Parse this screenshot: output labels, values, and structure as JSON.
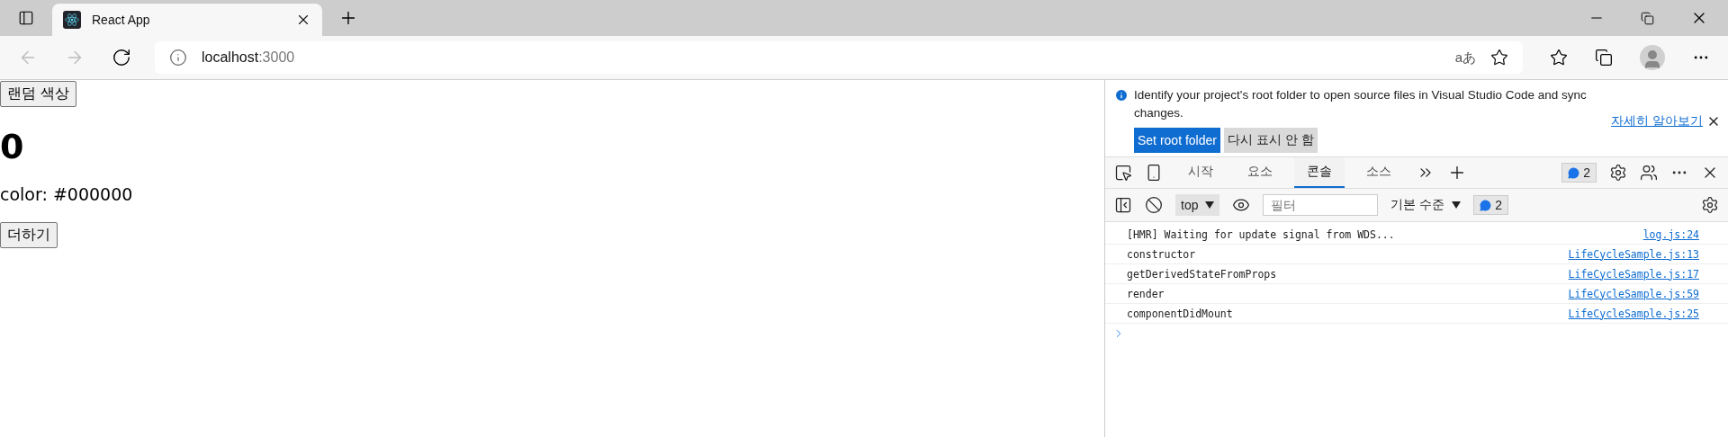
{
  "browser": {
    "tabs": [
      {
        "title": "React App",
        "selected": true
      }
    ],
    "address": {
      "host": "localhost",
      "port": ":3000"
    },
    "translate_label": "aあ"
  },
  "page": {
    "random_button": "랜덤 색상",
    "number": "0",
    "color_text": "color: #000000",
    "add_button": "더하기"
  },
  "devtools": {
    "infobar": {
      "message": "Identify your project's root folder to open source files in Visual Studio Code and sync changes.",
      "learn_more": "자세히 알아보기",
      "primary_button": "Set root folder",
      "secondary_button": "다시 표시 안 함"
    },
    "tabs": [
      {
        "label": "시작",
        "selected": false
      },
      {
        "label": "요소",
        "selected": false
      },
      {
        "label": "콘솔",
        "selected": true
      },
      {
        "label": "소스",
        "selected": false
      }
    ],
    "issues_count": "2",
    "toolbar": {
      "context": "top",
      "filter_placeholder": "필터",
      "level": "기본 수준",
      "message_count": "2"
    },
    "messages": [
      {
        "text": "[HMR] Waiting for update signal from WDS...",
        "source": "log.js:24"
      },
      {
        "text": "constructor",
        "source": "LifeCycleSample.js:13"
      },
      {
        "text": "getDerivedStateFromProps",
        "source": "LifeCycleSample.js:17"
      },
      {
        "text": "render",
        "source": "LifeCycleSample.js:59"
      },
      {
        "text": "componentDidMount",
        "source": "LifeCycleSample.js:25"
      }
    ]
  }
}
